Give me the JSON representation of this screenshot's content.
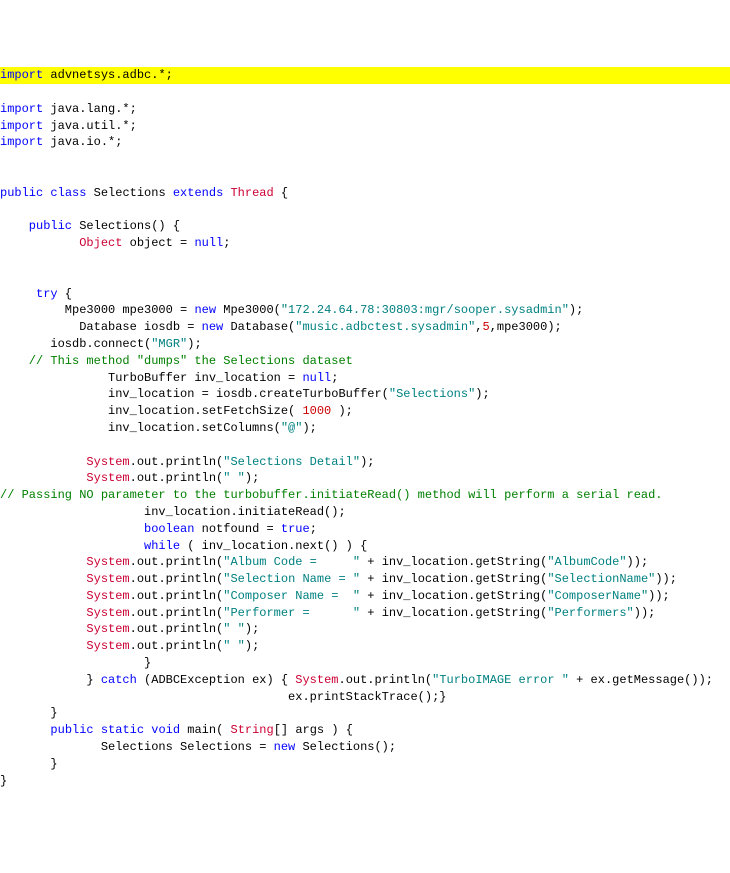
{
  "lines": {
    "l1_import": "import",
    "l1_pkg": " advnetsys.adbc.*;",
    "l3_import": "import",
    "l3_pkg": " java.lang.*;",
    "l4_import": "import",
    "l4_pkg": " java.util.*;",
    "l5_import": "import",
    "l5_pkg": " java.io.*;",
    "l8_public": "public",
    "l8_class": " class",
    "l8_name": " Selections",
    "l8_extends": " extends",
    "l8_thread": " Thread",
    "l8_brace": " {",
    "l10_public": "    public",
    "l10_name": " Selections()",
    "l10_brace": " {",
    "l11_object_type": "           Object",
    "l11_rest": " object = ",
    "l11_null": "null",
    "l11_semi": ";",
    "l14_try": "     try",
    "l14_brace": " {",
    "l15_indent": "         Mpe3000 mpe3000 = ",
    "l15_new": "new",
    "l15_ctor": " Mpe3000(",
    "l15_str": "\"172.24.64.78:30803:mgr/sooper.sysadmin\"",
    "l15_close": ");",
    "l16_indent": "           Database iosdb = ",
    "l16_new": "new",
    "l16_ctor": " Database(",
    "l16_str": "\"music.adbctest.sysadmin\"",
    "l16_comma": ",",
    "l16_num": "5",
    "l16_close": ",mpe3000);",
    "l17_indent": "       iosdb.connect(",
    "l17_str": "\"MGR\"",
    "l17_close": ");",
    "l18_comment": "    // This method \"dumps\" the Selections dataset",
    "l19_indent": "               TurboBuffer inv_location = ",
    "l19_null": "null",
    "l19_semi": ";",
    "l20_indent": "               inv_location = iosdb.createTurboBuffer(",
    "l20_str": "\"Selections\"",
    "l20_close": ");",
    "l21_indent": "               inv_location.setFetchSize( ",
    "l21_num": "1000",
    "l21_close": " );",
    "l22_indent": "               inv_location.setColumns(",
    "l22_str": "\"@\"",
    "l22_close": ");",
    "l24_indent": "            ",
    "l24_system": "System",
    "l24_out": ".out.println(",
    "l24_str": "\"Selections Detail\"",
    "l24_close": ");",
    "l25_indent": "            ",
    "l25_system": "System",
    "l25_out": ".out.println(",
    "l25_str": "\" \"",
    "l25_close": ");",
    "l26_comment": "// Passing NO parameter to the turbobuffer.initiateRead() method will perform a serial read.",
    "l27_indent": "                    inv_location.initiateRead();",
    "l28_indent": "                    ",
    "l28_boolean": "boolean",
    "l28_rest": " notfound = ",
    "l28_true": "true",
    "l28_semi": ";",
    "l29_indent": "                    ",
    "l29_while": "while",
    "l29_rest": " ( inv_location.next() ) {",
    "l30_indent": "            ",
    "l30_system": "System",
    "l30_out": ".out.println(",
    "l30_str1": "\"Album Code =     \"",
    "l30_plus": " + inv_location.getString(",
    "l30_str2": "\"AlbumCode\"",
    "l30_close": "));",
    "l31_indent": "            ",
    "l31_system": "System",
    "l31_out": ".out.println(",
    "l31_str1": "\"Selection Name = \"",
    "l31_plus": " + inv_location.getString(",
    "l31_str2": "\"SelectionName\"",
    "l31_close": "));",
    "l32_indent": "            ",
    "l32_system": "System",
    "l32_out": ".out.println(",
    "l32_str1": "\"Composer Name =  \"",
    "l32_plus": " + inv_location.getString(",
    "l32_str2": "\"ComposerName\"",
    "l32_close": "));",
    "l33_indent": "            ",
    "l33_system": "System",
    "l33_out": ".out.println(",
    "l33_str1": "\"Performer =      \"",
    "l33_plus": " + inv_location.getString(",
    "l33_str2": "\"Performers\"",
    "l33_close": "));",
    "l34_indent": "            ",
    "l34_system": "System",
    "l34_out": ".out.println(",
    "l34_str": "\" \"",
    "l34_close": ");",
    "l35_indent": "            ",
    "l35_system": "System",
    "l35_out": ".out.println(",
    "l35_str": "\" \"",
    "l35_close": ");",
    "l36_brace": "                    }",
    "l37_indent": "            } ",
    "l37_catch": "catch",
    "l37_paren": " (ADBCException ex) { ",
    "l37_system": "System",
    "l37_out": ".out.println(",
    "l37_str": "\"TurboIMAGE error \"",
    "l37_plus": " + ex.getMessage());",
    "l38_indent": "                                        ex.printStackTrace();}",
    "l39_brace": "       }",
    "l40_indent": "       ",
    "l40_public": "public",
    "l40_static": " static",
    "l40_void": " void",
    "l40_main": " main( ",
    "l40_string": "String",
    "l40_rest": "[] args ) {",
    "l41_indent": "              Selections Selections = ",
    "l41_new": "new",
    "l41_ctor": " Selections();",
    "l42_brace": "       }",
    "l43_brace": "}"
  }
}
